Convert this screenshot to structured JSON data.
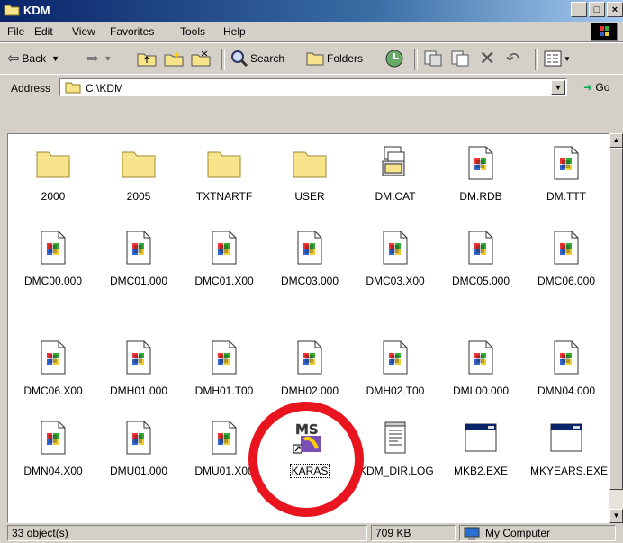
{
  "window": {
    "title": "KDM"
  },
  "menu": [
    "File",
    "Edit",
    "View",
    "Favorites",
    "Tools",
    "Help"
  ],
  "toolbar": {
    "back": "Back",
    "search": "Search",
    "folders": "Folders"
  },
  "address": {
    "label": "Address",
    "value": "C:\\KDM",
    "go": "Go"
  },
  "items": [
    {
      "name": "2000",
      "icon": "folder"
    },
    {
      "name": "2005",
      "icon": "folder"
    },
    {
      "name": "TXTNARTF",
      "icon": "folder"
    },
    {
      "name": "USER",
      "icon": "folder"
    },
    {
      "name": "DM.CAT",
      "icon": "catalog"
    },
    {
      "name": "DM.RDB",
      "icon": "win-file"
    },
    {
      "name": "DM.TTT",
      "icon": "win-file"
    },
    {
      "name": "DMC00.000",
      "icon": "win-file"
    },
    {
      "name": "DMC01.000",
      "icon": "win-file"
    },
    {
      "name": "DMC01.X00",
      "icon": "win-file"
    },
    {
      "name": "DMC03.000",
      "icon": "win-file"
    },
    {
      "name": "DMC03.X00",
      "icon": "win-file"
    },
    {
      "name": "DMC05.000",
      "icon": "win-file"
    },
    {
      "name": "DMC06.000",
      "icon": "win-file"
    },
    {
      "name": "DMC06.X00",
      "icon": "win-file"
    },
    {
      "name": "DMH01.000",
      "icon": "win-file"
    },
    {
      "name": "DMH01.T00",
      "icon": "win-file"
    },
    {
      "name": "DMH02.000",
      "icon": "win-file"
    },
    {
      "name": "DMH02.T00",
      "icon": "win-file"
    },
    {
      "name": "DML00.000",
      "icon": "win-file"
    },
    {
      "name": "DMN04.000",
      "icon": "win-file"
    },
    {
      "name": "DMN04.X00",
      "icon": "win-file"
    },
    {
      "name": "DMU01.000",
      "icon": "win-file"
    },
    {
      "name": "DMU01.X00",
      "icon": "win-file"
    },
    {
      "name": "KARAS",
      "icon": "ms-shortcut"
    },
    {
      "name": "KDM_DIR.LOG",
      "icon": "text-file"
    },
    {
      "name": "MKB2.EXE",
      "icon": "exe"
    },
    {
      "name": "MKYEARS.EXE",
      "icon": "exe"
    }
  ],
  "status": {
    "objects": "33 object(s)",
    "size": "709 KB",
    "zone": "My Computer"
  },
  "colors": {
    "highlight": "#e8141e",
    "titlebar": "#0a246a",
    "folder": "#f6e38a"
  }
}
